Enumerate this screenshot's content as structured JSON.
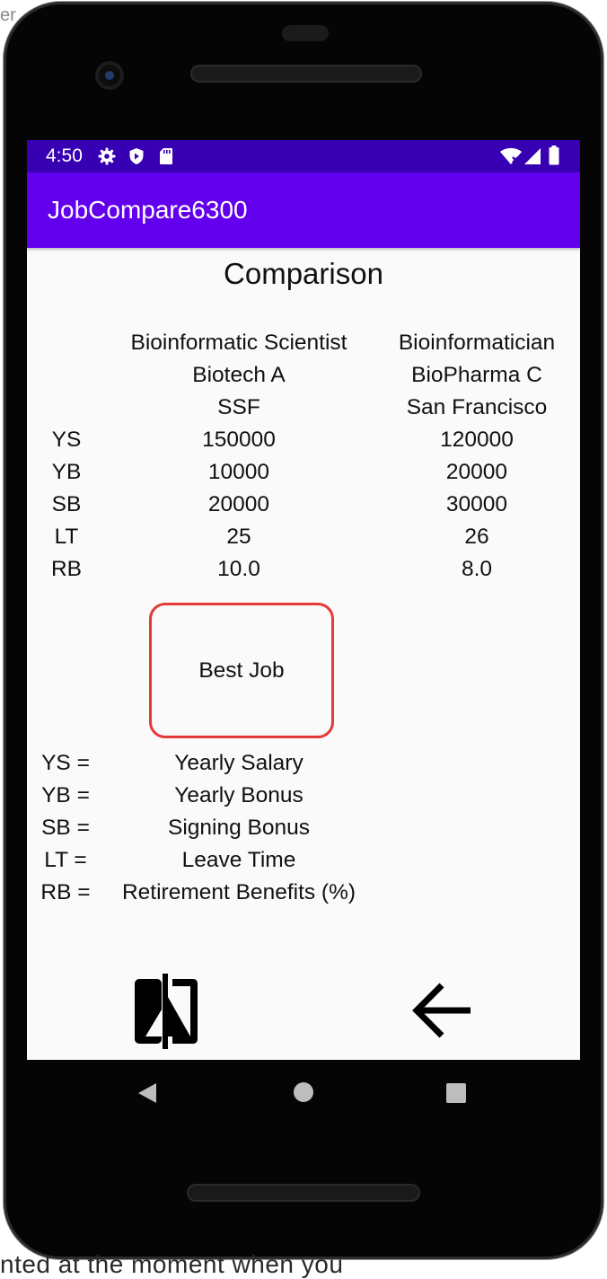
{
  "background": {
    "top_fragment": "er",
    "bottom_fragment": "nted at the moment when you"
  },
  "status_bar": {
    "time": "4:50",
    "left_icons": [
      "gear-icon",
      "shield-icon",
      "sd-card-icon"
    ],
    "right_icons": [
      "wifi-icon",
      "signal-icon",
      "battery-icon"
    ]
  },
  "app_bar": {
    "title": "JobCompare6300"
  },
  "screen": {
    "heading": "Comparison",
    "job1": {
      "title": "Bioinformatic Scientist",
      "company": "Biotech A",
      "location": "SSF"
    },
    "job2": {
      "title": "Bioinformatician",
      "company": "BioPharma C",
      "location": "San Francisco"
    },
    "rows": [
      {
        "label": "YS",
        "job1": "150000",
        "job2": "120000"
      },
      {
        "label": "YB",
        "job1": "10000",
        "job2": "20000"
      },
      {
        "label": "SB",
        "job1": "20000",
        "job2": "30000"
      },
      {
        "label": "LT",
        "job1": "25",
        "job2": "26"
      },
      {
        "label": "RB",
        "job1": "10.0",
        "job2": "8.0"
      }
    ],
    "best_job_label": "Best Job",
    "legend": [
      {
        "abbr": "YS =",
        "meaning": "Yearly Salary"
      },
      {
        "abbr": "YB =",
        "meaning": "Yearly Bonus"
      },
      {
        "abbr": "SB =",
        "meaning": "Signing Bonus"
      },
      {
        "abbr": "LT =",
        "meaning": "Leave Time"
      },
      {
        "abbr": "RB =",
        "meaning": "Retirement Benefits (%)"
      }
    ],
    "bottom_actions": [
      "compare-icon",
      "back-arrow-icon"
    ]
  },
  "nav_bar": {
    "buttons": [
      "back-triangle-icon",
      "home-circle-icon",
      "recents-square-icon"
    ]
  },
  "colors": {
    "status_bar": "#3700b3",
    "app_bar": "#6200ee",
    "best_job_border": "#e53935",
    "screen_bg": "#fafafa"
  }
}
